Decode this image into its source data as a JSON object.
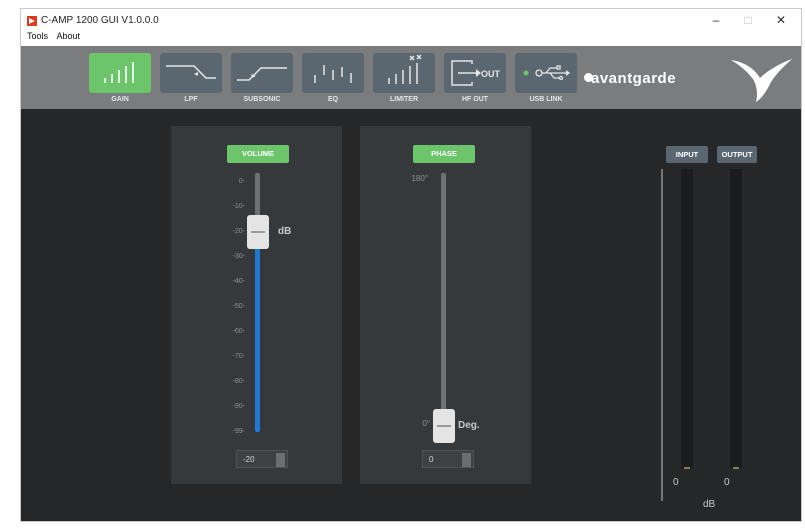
{
  "window": {
    "title": "C-AMP 1200  GUI V1.0.0.0",
    "minimize": "–",
    "maximize": "□",
    "close": "✕"
  },
  "menu": [
    "Tools",
    "About"
  ],
  "toolbar": {
    "items": [
      {
        "label": "GAIN",
        "icon": "gain-icon",
        "active": true
      },
      {
        "label": "LPF",
        "icon": "lpf-icon",
        "active": false
      },
      {
        "label": "SUBSONIC",
        "icon": "subsonic-icon",
        "active": false
      },
      {
        "label": "EQ",
        "icon": "eq-icon",
        "active": false
      },
      {
        "label": "LIMITER",
        "icon": "limiter-icon",
        "active": false
      },
      {
        "label": "HF OUT",
        "icon": "hf-out-icon",
        "active": false,
        "icon_text": "OUT"
      },
      {
        "label": "USB LINK",
        "icon": "usb-icon",
        "active": false
      }
    ],
    "brand": "avantgarde"
  },
  "volume": {
    "label": "VOLUME",
    "ticks": [
      "0-",
      "-10-",
      "-20-",
      "-30-",
      "-40-",
      "-50-",
      "-60-",
      "-70-",
      "-80-",
      "-90-",
      "-99-"
    ],
    "unit": "dB",
    "value": "-20",
    "level_db": -20
  },
  "phase": {
    "label": "PHASE",
    "top": "180°",
    "bottom": "0°",
    "unit": "Deg.",
    "value": "0",
    "level_deg": 0
  },
  "meters": {
    "input_label": "INPUT",
    "output_label": "OUTPUT",
    "input_value": "0",
    "output_value": "0",
    "unit": "dB"
  },
  "colors": {
    "active": "#6cc46b",
    "accent_blue": "#1f78d1",
    "toolbar": "#7b7c7d",
    "background": "#262729"
  }
}
